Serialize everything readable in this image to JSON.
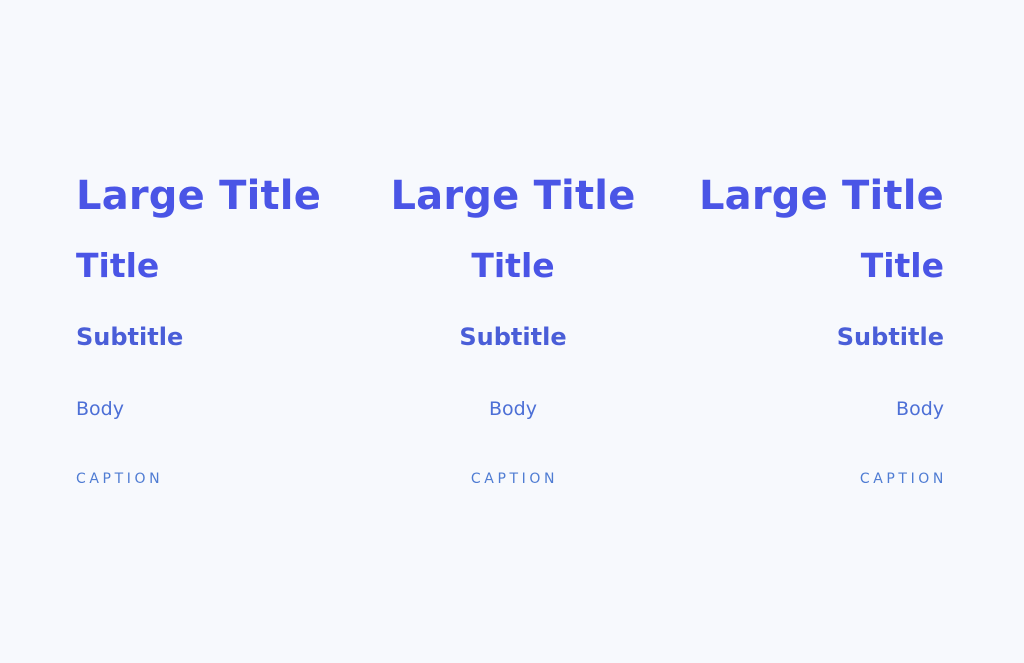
{
  "colors": {
    "background": "#f7f9fd",
    "large_title": "#4a55e6",
    "title": "#4a55e6",
    "subtitle": "#4a5ed8",
    "body": "#4c6fd6",
    "caption": "#4f7cd3"
  },
  "columns": [
    {
      "alignment": "left",
      "large_title": "Large Title",
      "title": "Title",
      "subtitle": "Subtitle",
      "body": "Body",
      "caption": "CAPTION"
    },
    {
      "alignment": "center",
      "large_title": "Large Title",
      "title": "Title",
      "subtitle": "Subtitle",
      "body": "Body",
      "caption": "CAPTION"
    },
    {
      "alignment": "right",
      "large_title": "Large Title",
      "title": "Title",
      "subtitle": "Subtitle",
      "body": "Body",
      "caption": "CAPTION"
    }
  ]
}
